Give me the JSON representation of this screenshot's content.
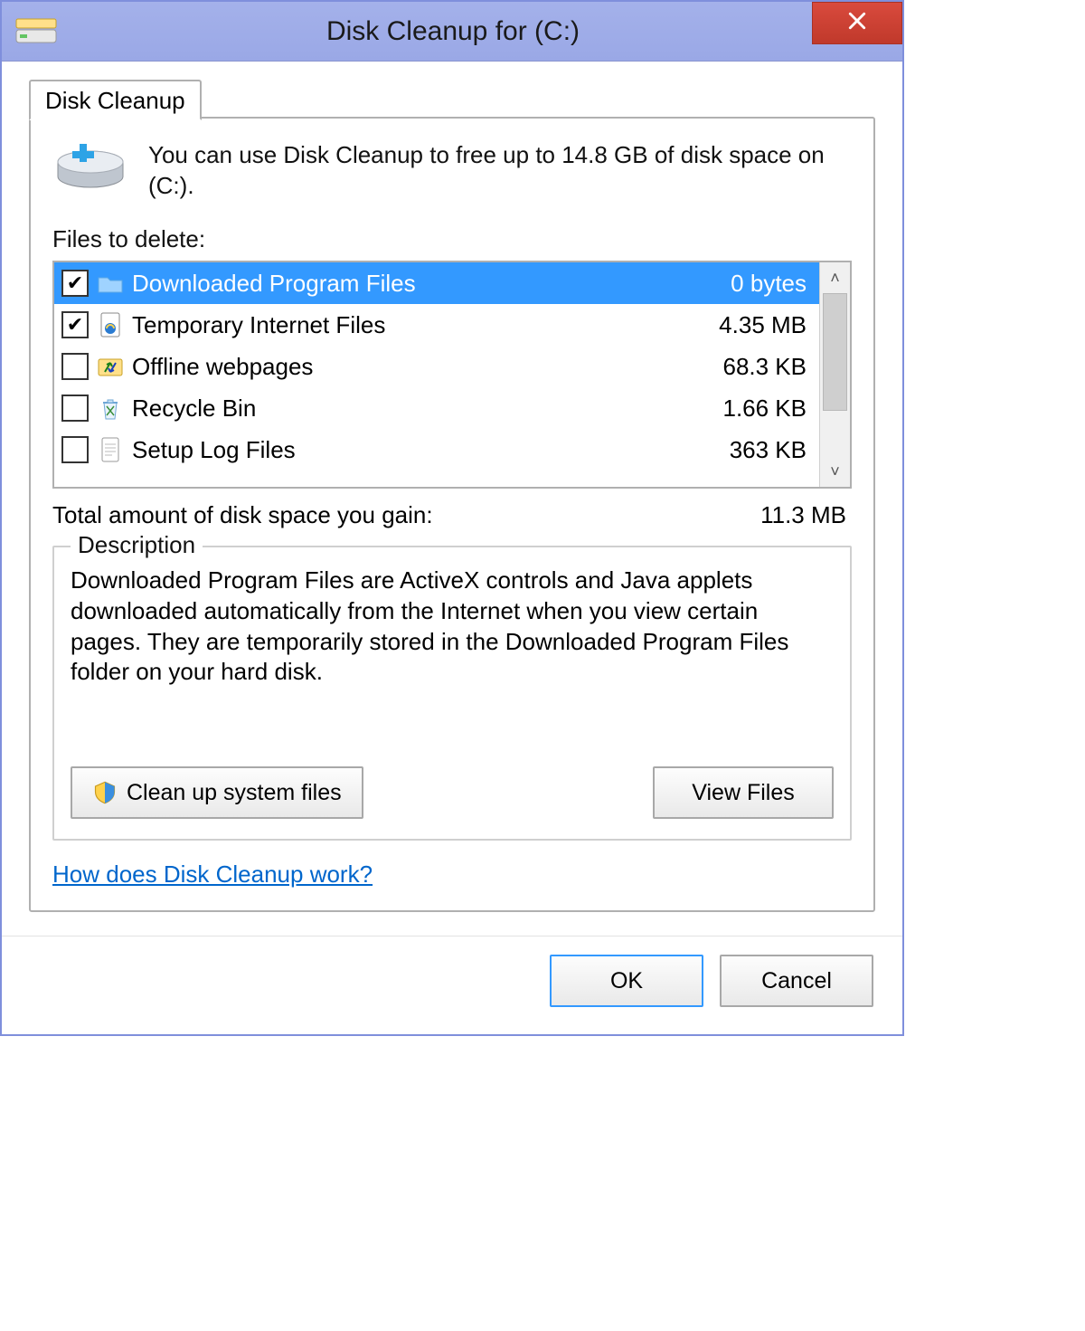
{
  "window": {
    "title": "Disk Cleanup for  (C:)"
  },
  "tab": {
    "label": "Disk Cleanup"
  },
  "intro": {
    "text": "You can use Disk Cleanup to free up to 14.8 GB of disk space on  (C:)."
  },
  "files_label": "Files to delete:",
  "files": [
    {
      "checked": true,
      "icon": "folder",
      "name": "Downloaded Program Files",
      "size": "0 bytes",
      "selected": true
    },
    {
      "checked": true,
      "icon": "iefile",
      "name": "Temporary Internet Files",
      "size": "4.35 MB",
      "selected": false
    },
    {
      "checked": false,
      "icon": "offline",
      "name": "Offline webpages",
      "size": "68.3 KB",
      "selected": false
    },
    {
      "checked": false,
      "icon": "recycle",
      "name": "Recycle Bin",
      "size": "1.66 KB",
      "selected": false
    },
    {
      "checked": false,
      "icon": "logfile",
      "name": "Setup Log Files",
      "size": "363 KB",
      "selected": false
    }
  ],
  "total": {
    "label": "Total amount of disk space you gain:",
    "value": "11.3 MB"
  },
  "description": {
    "legend": "Description",
    "text": "Downloaded Program Files are ActiveX controls and Java applets downloaded automatically from the Internet when you view certain pages. They are temporarily stored in the Downloaded Program Files folder on your hard disk."
  },
  "buttons": {
    "cleanup_system": "Clean up system files",
    "view_files": "View Files",
    "ok": "OK",
    "cancel": "Cancel"
  },
  "help_link": "How does Disk Cleanup work?"
}
